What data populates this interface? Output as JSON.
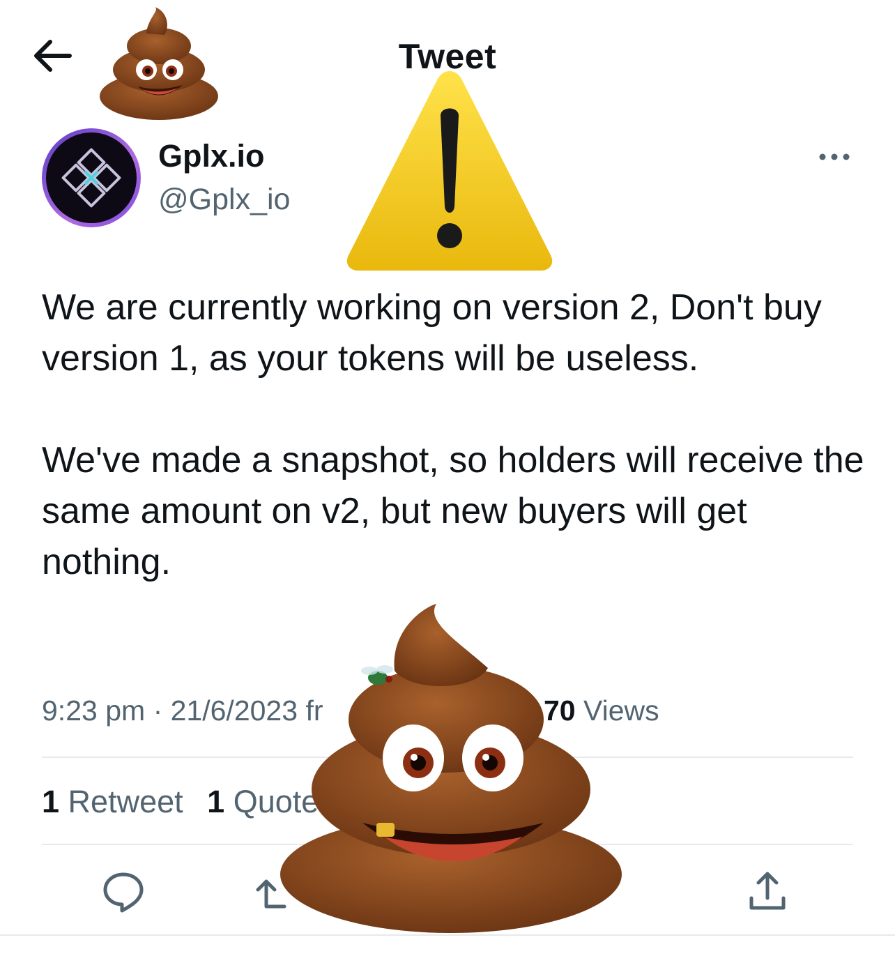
{
  "header": {
    "title": "Tweet"
  },
  "author": {
    "display_name": "Gplx.io",
    "handle": "@Gplx_io"
  },
  "tweet": {
    "paragraphs": [
      "We are currently working on version 2, Don't buy version 1, as your tokens will be useless.",
      "We've made a snapshot, so holders will receive the same amount on v2, but new buyers will get nothing."
    ]
  },
  "meta": {
    "time": "9:23 pm",
    "separator": "·",
    "date": "21/6/2023",
    "source_fragment": "fr",
    "views_count_fragment": "70",
    "views_label": "Views"
  },
  "stats": {
    "retweets_count": "1",
    "retweets_label": "Retweet",
    "quotes_count": "1",
    "quotes_label": "Quote"
  },
  "icons": {
    "back": "arrow-left-icon",
    "more": "more-horizontal-icon",
    "reply": "reply-icon",
    "retweet": "retweet-icon",
    "share": "share-icon",
    "overlay_small": "poop-emoji",
    "overlay_warning": "warning-sign",
    "overlay_large": "poop-emoji"
  },
  "colors": {
    "text": "#0f1419",
    "secondary": "#536471",
    "divider": "#e7e9ea",
    "warning_yellow": "#f6cc16",
    "poop_brown": "#8a4a1f",
    "avatar_ring": "#9b5de5"
  }
}
